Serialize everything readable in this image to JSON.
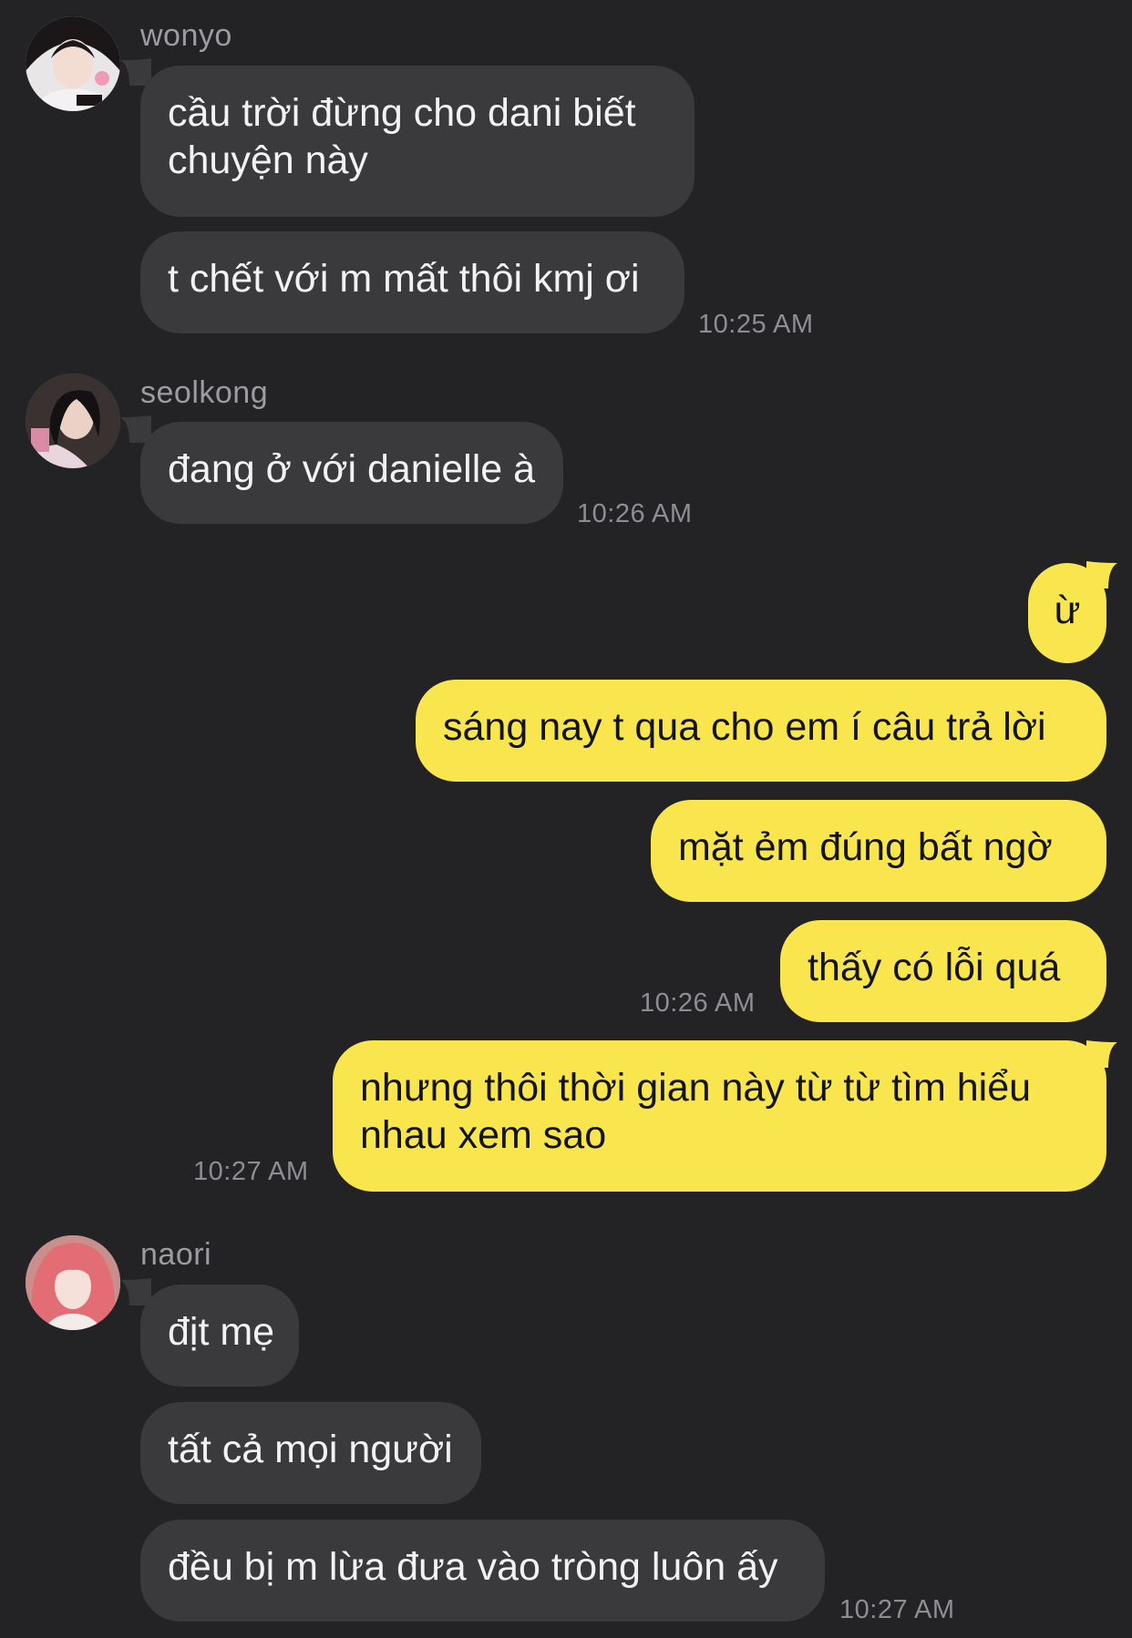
{
  "colors": {
    "background": "#232325",
    "incoming_bubble": "#3a3a3d",
    "outgoing_bubble": "#f9e54e",
    "timestamp": "#8e8e92",
    "sender_name": "#9c9ca0"
  },
  "groups": [
    {
      "sender": "wonyo",
      "avatar_icon": "profile-photo-avatar",
      "messages": [
        "cầu trời đừng cho dani biết",
        "chuyện này",
        "t chết với m mất thôi kmj ơi"
      ],
      "time": "10:25 AM"
    },
    {
      "sender": "seolkong",
      "avatar_icon": "profile-photo-avatar",
      "messages": [
        "đang ở với danielle à"
      ],
      "time": "10:26 AM"
    },
    {
      "sender": "me",
      "messages": [
        "ừ",
        "sáng nay t qua cho em í câu trả lời",
        "mặt ẻm đúng bất ngờ",
        "thấy có lỗi quá"
      ],
      "time": "10:26 AM"
    },
    {
      "sender": "me",
      "messages": [
        "nhưng thôi thời gian này từ từ tìm hiểu",
        "nhau xem sao"
      ],
      "time": "10:27 AM"
    },
    {
      "sender": "naori",
      "avatar_icon": "profile-photo-avatar",
      "messages": [
        "địt mẹ",
        "tất cả mọi người",
        "đều bị m lừa đưa vào tròng luôn ấy"
      ],
      "time": "10:27 AM"
    }
  ]
}
